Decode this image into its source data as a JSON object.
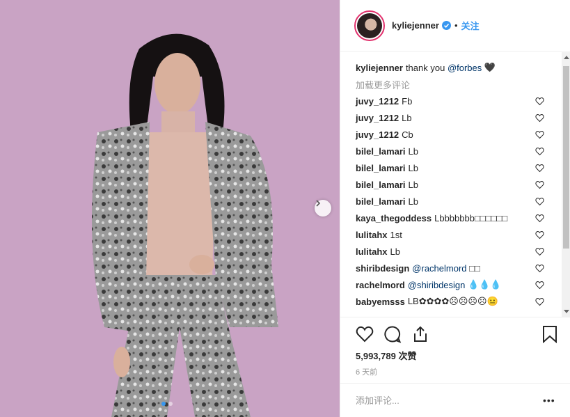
{
  "post": {
    "author": "kyliejenner",
    "follow_label": "关注",
    "separator": "•",
    "caption": "thank you",
    "caption_mention": "@forbes",
    "caption_emoji": "🖤",
    "load_more": "加载更多评论",
    "likes": "5,993,789 次赞",
    "age": "6 天前",
    "comment_placeholder": "添加评论...",
    "more_label": "•••"
  },
  "comments": [
    {
      "user": "juvy_1212",
      "text": "Fb"
    },
    {
      "user": "juvy_1212",
      "text": "Lb"
    },
    {
      "user": "juvy_1212",
      "text": "Cb"
    },
    {
      "user": "bilel_lamari",
      "text": "Lb"
    },
    {
      "user": "bilel_lamari",
      "text": "Lb"
    },
    {
      "user": "bilel_lamari",
      "text": "Lb"
    },
    {
      "user": "bilel_lamari",
      "text": "Lb"
    },
    {
      "user": "kaya_thegoddess",
      "text": "Lbbbbbbb□□□□□□"
    },
    {
      "user": "lulitahx",
      "text": "1st"
    },
    {
      "user": "lulitahx",
      "text": "Lb"
    },
    {
      "user": "shiribdesign",
      "mention": "@rachelmord",
      "text": "□□"
    },
    {
      "user": "rachelmord",
      "mention": "@shiribdesign",
      "text": "💧💧💧"
    },
    {
      "user": "babyemsss",
      "text": "LB✿✿✿✿☹☹☹☹😐"
    }
  ],
  "icons": {
    "verified": "verified-badge-icon",
    "like": "heart-icon",
    "comment": "comment-icon",
    "share": "share-icon",
    "save": "bookmark-icon",
    "next": "chevron-right-icon"
  },
  "colors": {
    "accent": "#3897f0",
    "mention": "#003569",
    "muted": "#999999",
    "photo_bg": "#c9a3c4"
  }
}
